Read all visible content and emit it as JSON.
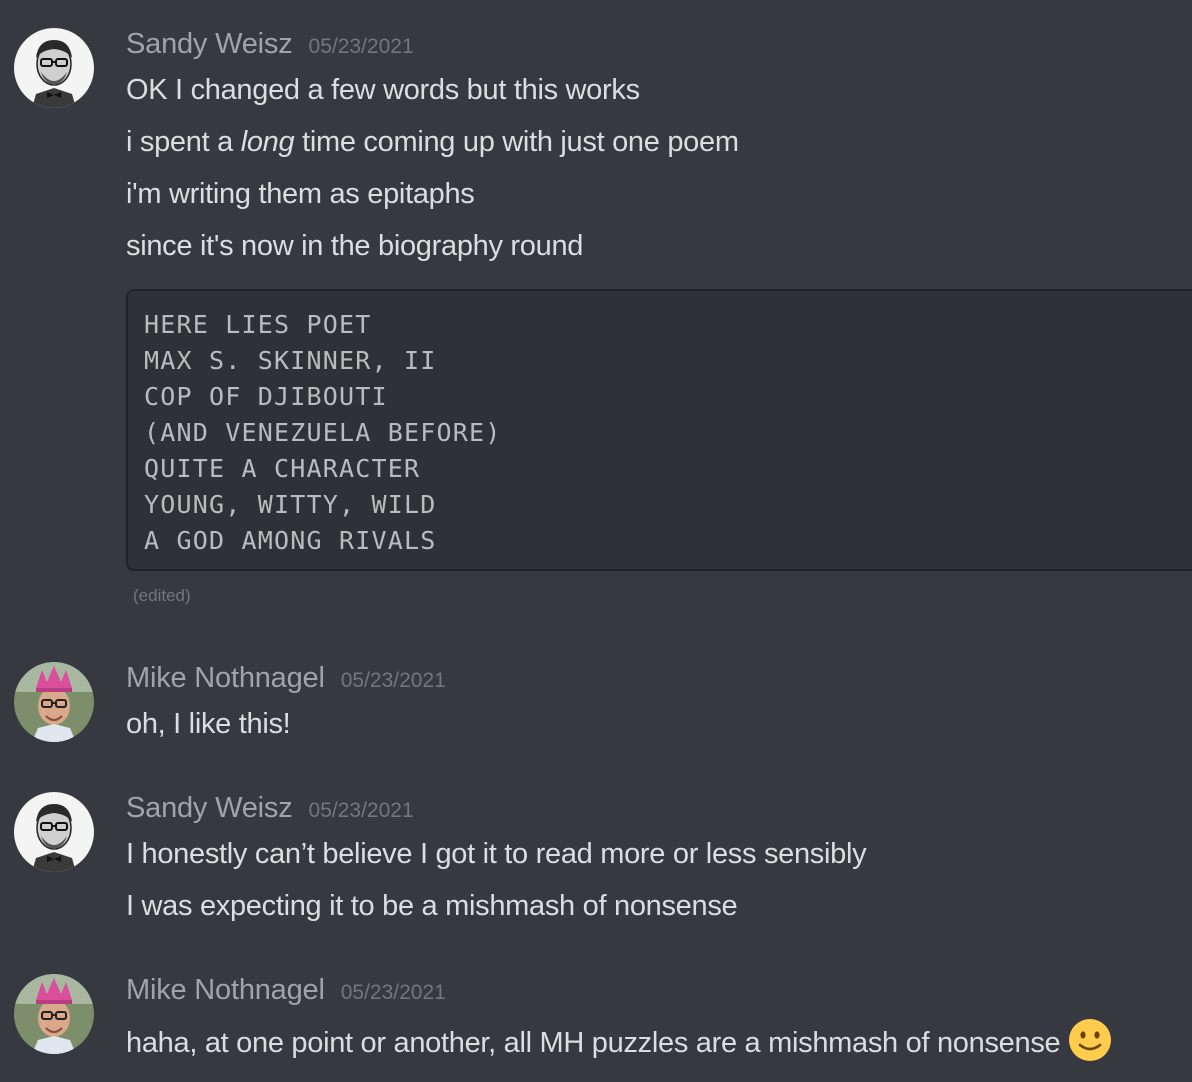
{
  "messages": [
    {
      "author": "Sandy Weisz",
      "timestamp": "05/23/2021",
      "lines": [
        "OK I changed a few words but this works",
        "i spent a ",
        "long",
        " time coming up with just one poem",
        "i'm writing them as epitaphs",
        "since it's now in the biography round"
      ],
      "code": [
        "HERE LIES POET",
        "MAX S. SKINNER, II",
        "COP OF DJIBOUTI",
        "(AND VENEZUELA BEFORE)",
        "QUITE A CHARACTER",
        "YOUNG, WITTY, WILD",
        "A GOD AMONG RIVALS"
      ],
      "edited_label": "(edited)"
    },
    {
      "author": "Mike Nothnagel",
      "timestamp": "05/23/2021",
      "lines": [
        "oh, I like this!"
      ]
    },
    {
      "author": "Sandy Weisz",
      "timestamp": "05/23/2021",
      "lines": [
        "I honestly can’t believe I got it to read more or less sensibly",
        "I was expecting it to be a mishmash of nonsense"
      ]
    },
    {
      "author": "Mike Nothnagel",
      "timestamp": "05/23/2021",
      "lines": [
        "haha, at one point or another, all MH puzzles are a mishmash of nonsense"
      ],
      "emoji": "slightly-smiling-face-emoji"
    }
  ],
  "colors": {
    "background": "#36393f",
    "username": "#9ea4a8",
    "timestamp": "#72767d",
    "text": "#dcddde",
    "code_bg": "#2f3136"
  }
}
